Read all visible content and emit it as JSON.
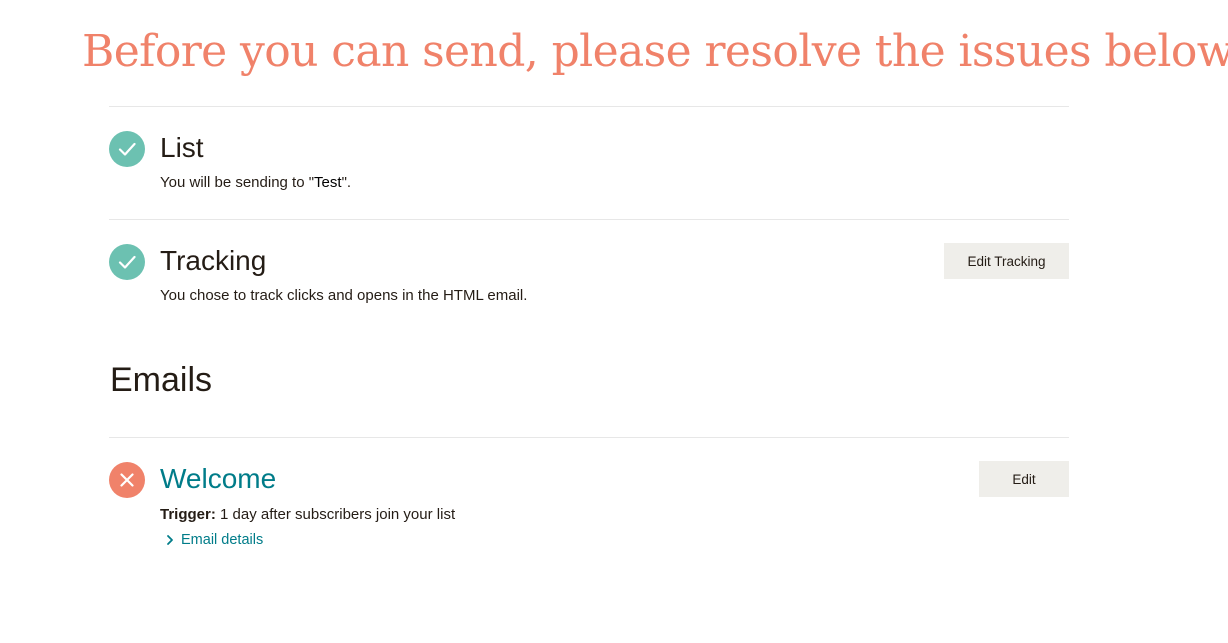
{
  "headline": "Before you can send, please resolve the issues below:",
  "checklist": {
    "list": {
      "title": "List",
      "desc_prefix": "You will be sending to \"",
      "list_name": "Test",
      "desc_suffix": "\".",
      "status": "complete",
      "status_icon": "check-icon"
    },
    "tracking": {
      "title": "Tracking",
      "desc": "You chose to track clicks and opens in the HTML email.",
      "button_label": "Edit Tracking",
      "status": "complete",
      "status_icon": "check-icon"
    }
  },
  "emails": {
    "heading": "Emails",
    "items": [
      {
        "title": "Welcome",
        "trigger_label": "Trigger:",
        "trigger_value": " 1 day after subscribers join your list",
        "details_link": "Email details",
        "button_label": "Edit",
        "status": "error",
        "status_icon": "x-icon"
      }
    ]
  },
  "colors": {
    "headline": "#f0826a",
    "success": "#6cc1b1",
    "error": "#f0826a",
    "link": "#007c89",
    "button_bg": "#efeeea",
    "text": "#241c15"
  }
}
